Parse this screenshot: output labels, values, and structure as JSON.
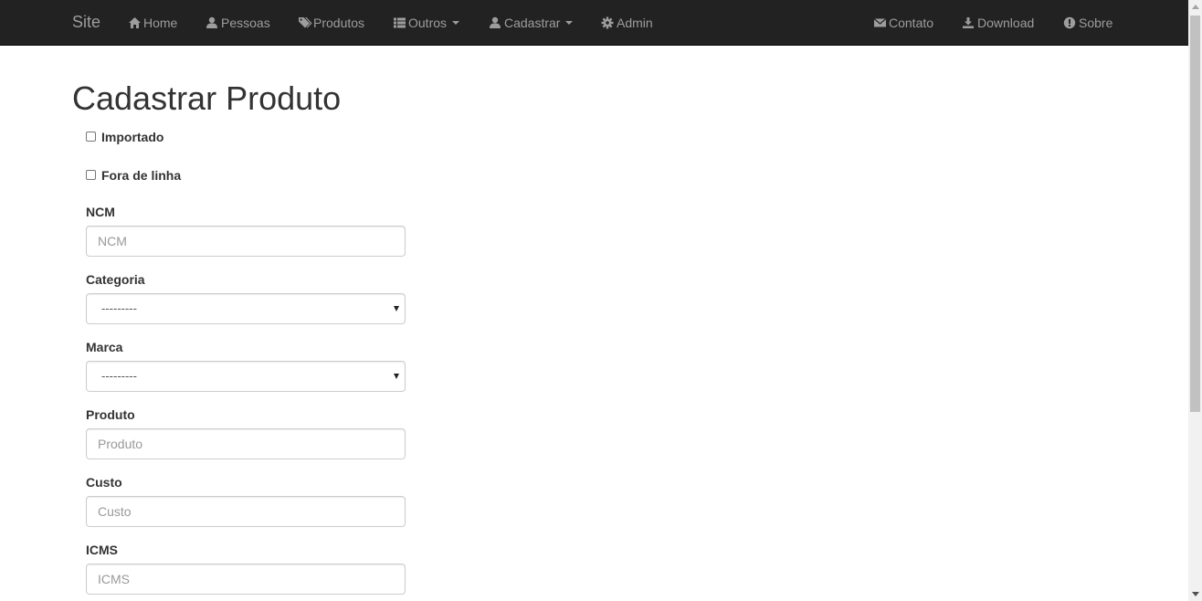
{
  "navbar": {
    "brand": "Site",
    "left_items": [
      {
        "label": "Home",
        "icon": "home-icon"
      },
      {
        "label": "Pessoas",
        "icon": "user-icon"
      },
      {
        "label": "Produtos",
        "icon": "tags-icon"
      },
      {
        "label": "Outros",
        "icon": "list-icon",
        "dropdown": true
      },
      {
        "label": "Cadastrar",
        "icon": "user-icon",
        "dropdown": true
      },
      {
        "label": "Admin",
        "icon": "gear-icon"
      }
    ],
    "right_items": [
      {
        "label": "Contato",
        "icon": "envelope-icon"
      },
      {
        "label": "Download",
        "icon": "download-icon"
      },
      {
        "label": "Sobre",
        "icon": "exclamation-circle-icon"
      }
    ]
  },
  "page": {
    "title": "Cadastrar Produto"
  },
  "form": {
    "importado": {
      "label": "Importado",
      "checked": false
    },
    "fora_de_linha": {
      "label": "Fora de linha",
      "checked": false
    },
    "ncm": {
      "label": "NCM",
      "placeholder": "NCM",
      "value": ""
    },
    "categoria": {
      "label": "Categoria",
      "selected": "---------"
    },
    "marca": {
      "label": "Marca",
      "selected": "---------"
    },
    "produto": {
      "label": "Produto",
      "placeholder": "Produto",
      "value": ""
    },
    "custo": {
      "label": "Custo",
      "placeholder": "Custo",
      "value": ""
    },
    "icms": {
      "label": "ICMS",
      "placeholder": "ICMS",
      "value": ""
    }
  },
  "colors": {
    "navbar_bg": "#222222",
    "navbar_text": "#9d9d9d",
    "text": "#333333",
    "input_border": "#cccccc",
    "placeholder": "#999999"
  }
}
